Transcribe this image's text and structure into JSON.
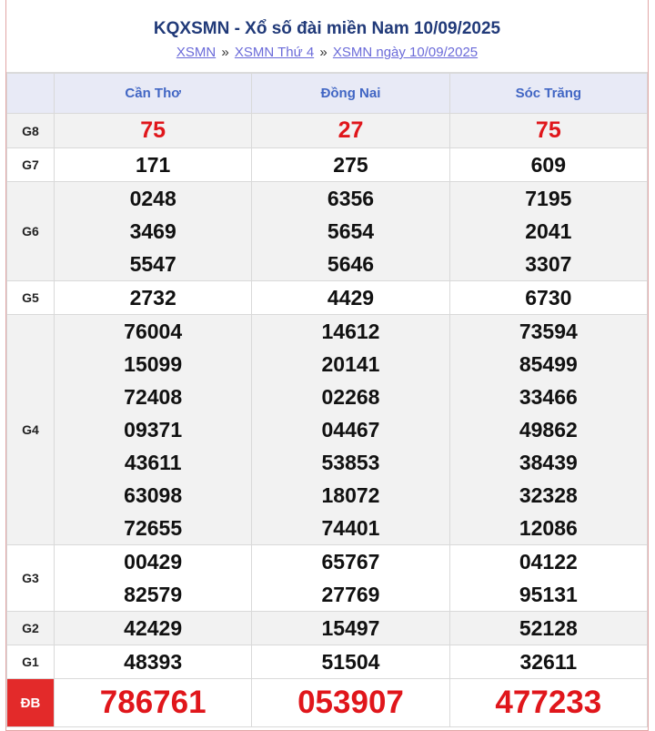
{
  "header": {
    "title": "KQXSMN - Xổ số đài miền Nam 10/09/2025",
    "breadcrumb": [
      {
        "label": "XSMN"
      },
      {
        "label": "XSMN Thứ 4"
      },
      {
        "label": "XSMN ngày 10/09/2025"
      }
    ],
    "separator": "»"
  },
  "columns": [
    "Cần Thơ",
    "Đồng Nai",
    "Sóc Trăng"
  ],
  "prizes": [
    {
      "label": "G8",
      "values": [
        [
          "75"
        ],
        [
          "27"
        ],
        [
          "75"
        ]
      ]
    },
    {
      "label": "G7",
      "values": [
        [
          "171"
        ],
        [
          "275"
        ],
        [
          "609"
        ]
      ]
    },
    {
      "label": "G6",
      "values": [
        [
          "0248",
          "3469",
          "5547"
        ],
        [
          "6356",
          "5654",
          "5646"
        ],
        [
          "7195",
          "2041",
          "3307"
        ]
      ]
    },
    {
      "label": "G5",
      "values": [
        [
          "2732"
        ],
        [
          "4429"
        ],
        [
          "6730"
        ]
      ]
    },
    {
      "label": "G4",
      "values": [
        [
          "76004",
          "15099",
          "72408",
          "09371",
          "43611",
          "63098",
          "72655"
        ],
        [
          "14612",
          "20141",
          "02268",
          "04467",
          "53853",
          "18072",
          "74401"
        ],
        [
          "73594",
          "85499",
          "33466",
          "49862",
          "38439",
          "32328",
          "12086"
        ]
      ]
    },
    {
      "label": "G3",
      "values": [
        [
          "00429",
          "82579"
        ],
        [
          "65767",
          "27769"
        ],
        [
          "04122",
          "95131"
        ]
      ]
    },
    {
      "label": "G2",
      "values": [
        [
          "42429"
        ],
        [
          "15497"
        ],
        [
          "52128"
        ]
      ]
    },
    {
      "label": "G1",
      "values": [
        [
          "48393"
        ],
        [
          "51504"
        ],
        [
          "32611"
        ]
      ]
    },
    {
      "label": "ĐB",
      "values": [
        [
          "786761"
        ],
        [
          "053907"
        ],
        [
          "477233"
        ]
      ]
    }
  ]
}
